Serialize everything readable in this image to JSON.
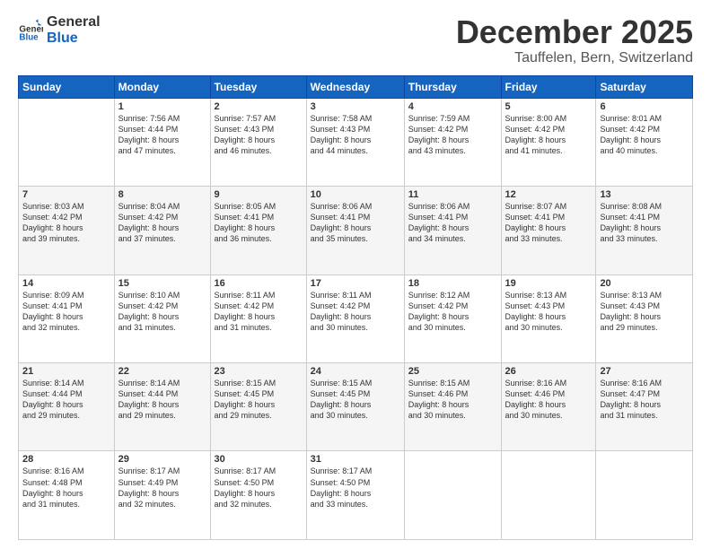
{
  "logo": {
    "line1": "General",
    "line2": "Blue"
  },
  "title": "December 2025",
  "subtitle": "Tauffelen, Bern, Switzerland",
  "days_of_week": [
    "Sunday",
    "Monday",
    "Tuesday",
    "Wednesday",
    "Thursday",
    "Friday",
    "Saturday"
  ],
  "weeks": [
    [
      {
        "day": "",
        "info": ""
      },
      {
        "day": "1",
        "info": "Sunrise: 7:56 AM\nSunset: 4:44 PM\nDaylight: 8 hours\nand 47 minutes."
      },
      {
        "day": "2",
        "info": "Sunrise: 7:57 AM\nSunset: 4:43 PM\nDaylight: 8 hours\nand 46 minutes."
      },
      {
        "day": "3",
        "info": "Sunrise: 7:58 AM\nSunset: 4:43 PM\nDaylight: 8 hours\nand 44 minutes."
      },
      {
        "day": "4",
        "info": "Sunrise: 7:59 AM\nSunset: 4:42 PM\nDaylight: 8 hours\nand 43 minutes."
      },
      {
        "day": "5",
        "info": "Sunrise: 8:00 AM\nSunset: 4:42 PM\nDaylight: 8 hours\nand 41 minutes."
      },
      {
        "day": "6",
        "info": "Sunrise: 8:01 AM\nSunset: 4:42 PM\nDaylight: 8 hours\nand 40 minutes."
      }
    ],
    [
      {
        "day": "7",
        "info": "Sunrise: 8:03 AM\nSunset: 4:42 PM\nDaylight: 8 hours\nand 39 minutes."
      },
      {
        "day": "8",
        "info": "Sunrise: 8:04 AM\nSunset: 4:42 PM\nDaylight: 8 hours\nand 37 minutes."
      },
      {
        "day": "9",
        "info": "Sunrise: 8:05 AM\nSunset: 4:41 PM\nDaylight: 8 hours\nand 36 minutes."
      },
      {
        "day": "10",
        "info": "Sunrise: 8:06 AM\nSunset: 4:41 PM\nDaylight: 8 hours\nand 35 minutes."
      },
      {
        "day": "11",
        "info": "Sunrise: 8:06 AM\nSunset: 4:41 PM\nDaylight: 8 hours\nand 34 minutes."
      },
      {
        "day": "12",
        "info": "Sunrise: 8:07 AM\nSunset: 4:41 PM\nDaylight: 8 hours\nand 33 minutes."
      },
      {
        "day": "13",
        "info": "Sunrise: 8:08 AM\nSunset: 4:41 PM\nDaylight: 8 hours\nand 33 minutes."
      }
    ],
    [
      {
        "day": "14",
        "info": "Sunrise: 8:09 AM\nSunset: 4:41 PM\nDaylight: 8 hours\nand 32 minutes."
      },
      {
        "day": "15",
        "info": "Sunrise: 8:10 AM\nSunset: 4:42 PM\nDaylight: 8 hours\nand 31 minutes."
      },
      {
        "day": "16",
        "info": "Sunrise: 8:11 AM\nSunset: 4:42 PM\nDaylight: 8 hours\nand 31 minutes."
      },
      {
        "day": "17",
        "info": "Sunrise: 8:11 AM\nSunset: 4:42 PM\nDaylight: 8 hours\nand 30 minutes."
      },
      {
        "day": "18",
        "info": "Sunrise: 8:12 AM\nSunset: 4:42 PM\nDaylight: 8 hours\nand 30 minutes."
      },
      {
        "day": "19",
        "info": "Sunrise: 8:13 AM\nSunset: 4:43 PM\nDaylight: 8 hours\nand 30 minutes."
      },
      {
        "day": "20",
        "info": "Sunrise: 8:13 AM\nSunset: 4:43 PM\nDaylight: 8 hours\nand 29 minutes."
      }
    ],
    [
      {
        "day": "21",
        "info": "Sunrise: 8:14 AM\nSunset: 4:44 PM\nDaylight: 8 hours\nand 29 minutes."
      },
      {
        "day": "22",
        "info": "Sunrise: 8:14 AM\nSunset: 4:44 PM\nDaylight: 8 hours\nand 29 minutes."
      },
      {
        "day": "23",
        "info": "Sunrise: 8:15 AM\nSunset: 4:45 PM\nDaylight: 8 hours\nand 29 minutes."
      },
      {
        "day": "24",
        "info": "Sunrise: 8:15 AM\nSunset: 4:45 PM\nDaylight: 8 hours\nand 30 minutes."
      },
      {
        "day": "25",
        "info": "Sunrise: 8:15 AM\nSunset: 4:46 PM\nDaylight: 8 hours\nand 30 minutes."
      },
      {
        "day": "26",
        "info": "Sunrise: 8:16 AM\nSunset: 4:46 PM\nDaylight: 8 hours\nand 30 minutes."
      },
      {
        "day": "27",
        "info": "Sunrise: 8:16 AM\nSunset: 4:47 PM\nDaylight: 8 hours\nand 31 minutes."
      }
    ],
    [
      {
        "day": "28",
        "info": "Sunrise: 8:16 AM\nSunset: 4:48 PM\nDaylight: 8 hours\nand 31 minutes."
      },
      {
        "day": "29",
        "info": "Sunrise: 8:17 AM\nSunset: 4:49 PM\nDaylight: 8 hours\nand 32 minutes."
      },
      {
        "day": "30",
        "info": "Sunrise: 8:17 AM\nSunset: 4:50 PM\nDaylight: 8 hours\nand 32 minutes."
      },
      {
        "day": "31",
        "info": "Sunrise: 8:17 AM\nSunset: 4:50 PM\nDaylight: 8 hours\nand 33 minutes."
      },
      {
        "day": "",
        "info": ""
      },
      {
        "day": "",
        "info": ""
      },
      {
        "day": "",
        "info": ""
      }
    ]
  ]
}
